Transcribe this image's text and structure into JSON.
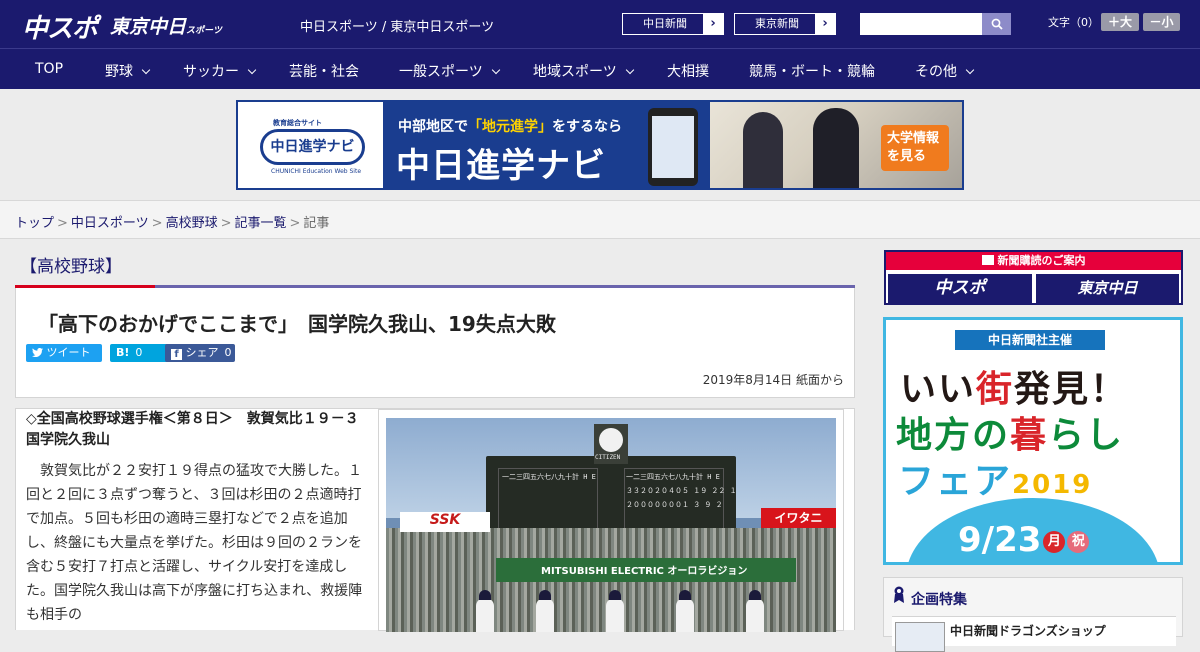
{
  "header": {
    "logo_primary": "中スポ",
    "logo_secondary": "東京中日",
    "logo_secondary_small": "スポーツ",
    "site_name": "中日スポーツ / 東京中日スポーツ",
    "links": [
      "中日新聞",
      "東京新聞"
    ],
    "link_arrow": "›",
    "search": {
      "value": "",
      "placeholder": ""
    },
    "font_size_label": "文字（0）",
    "font_increase": "＋大",
    "font_decrease": "－小"
  },
  "nav": {
    "items": [
      {
        "label": "TOP",
        "has_menu": false
      },
      {
        "label": "野球",
        "has_menu": true
      },
      {
        "label": "サッカー",
        "has_menu": true
      },
      {
        "label": "芸能・社会",
        "has_menu": false
      },
      {
        "label": "一般スポーツ",
        "has_menu": true
      },
      {
        "label": "地域スポーツ",
        "has_menu": true
      },
      {
        "label": "大相撲",
        "has_menu": false
      },
      {
        "label": "競馬・ボート・競輪",
        "has_menu": false
      },
      {
        "label": "その他",
        "has_menu": true
      }
    ]
  },
  "banner": {
    "logo_text": "中日進学ナビ",
    "logo_sub": "教育総合サイト",
    "logo_en": "CHUNICHI Education Web Site",
    "sub_pre": "中部地区で",
    "sub_highlight": "「地元進学」",
    "sub_post": "をするなら",
    "main": "中日進学ナビ",
    "cta_line1": "大学情報",
    "cta_line2": "を見る"
  },
  "breadcrumb": {
    "items": [
      "トップ",
      "中日スポーツ",
      "高校野球",
      "記事一覧"
    ],
    "current": "記事",
    "separator": ">"
  },
  "article": {
    "category": "【高校野球】",
    "title": "「高下のおかげでここまで」　国学院久我山、19失点大敗",
    "share": {
      "tweet_label": "ツイート",
      "hatena_label": "B!",
      "hatena_count": "0",
      "facebook_label": "シェア",
      "facebook_count": "0"
    },
    "date": "2019年8月14日 紙面から",
    "lead": "◇全国高校野球選手権＜第８日＞　敦賀気比１９－３国学院久我山",
    "body": "敦賀気比が２２安打１９得点の猛攻で大勝した。１回と２回に３点ずつ奪うと、３回は杉田の２点適時打で加点。５回も杉田の適時三塁打などで２点を追加し、終盤にも大量点を挙げた。杉田は９回の２ランを含む５安打７打点と活躍し、サイクル安打を達成した。国学院久我山は高下が序盤に打ち込まれ、救援陣も相手の",
    "photo": {
      "scoreboard_maker": "CITIZEN",
      "ad_left": "SSK",
      "ad_right": "イワタニ",
      "ad_wall": "MITSUBISHI ELECTRIC オーロラビジョン",
      "score_rows": [
        "一二三四五六七八九十計 H E",
        "３３２０２０４０５ １９ ２２ １",
        "２０００００００１ ３ ９ ２"
      ]
    }
  },
  "sidebar": {
    "subscribe_head": "新聞購読のご案内",
    "subscribe_logos": [
      "中スポ",
      "東京中日"
    ],
    "fair": {
      "tag": "中日新聞社主催",
      "line1_a": "いい",
      "line1_b": "街",
      "line1_c": "発見！",
      "line2_a": "地方の",
      "line2_b": "暮",
      "line2_c": "らし",
      "line3": "フェア",
      "year": "2019",
      "date_num": "9/23",
      "date_day": "月",
      "date_hol": "祝"
    },
    "feature": {
      "title": "企画特集",
      "item": "中日新聞ドラゴンズショップ"
    }
  },
  "colors": {
    "brand_navy": "#1b1a6e",
    "accent_red": "#d6001c",
    "twitter_blue": "#1da1f2",
    "hatena_blue": "#00a4de",
    "facebook_blue": "#3b5998"
  }
}
